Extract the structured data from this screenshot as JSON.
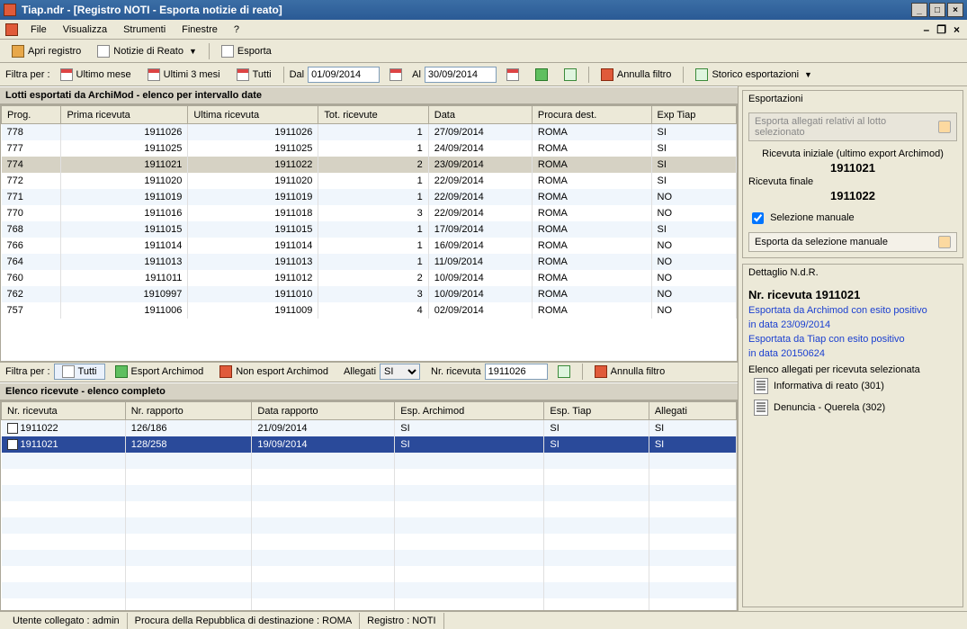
{
  "window": {
    "title": "Tiap.ndr - [Registro NOTI - Esporta notizie di reato]"
  },
  "menu": {
    "file": "File",
    "visualizza": "Visualizza",
    "strumenti": "Strumenti",
    "finestre": "Finestre",
    "help": "?"
  },
  "toolbar": {
    "apri_registro": "Apri registro",
    "notizie_di_reato": "Notizie di Reato",
    "esporta": "Esporta"
  },
  "filter_top": {
    "label": "Filtra per :",
    "ultimo_mese": "Ultimo mese",
    "ultimi_3_mesi": "Ultimi 3 mesi",
    "tutti": "Tutti",
    "dal_label": "Dal",
    "dal_value": "01/09/2014",
    "al_label": "Al",
    "al_value": "30/09/2014",
    "annulla_filtro": "Annulla filtro",
    "storico_esportazioni": "Storico esportazioni"
  },
  "grid_top": {
    "title": "Lotti esportati da ArchiMod - elenco per intervallo date",
    "columns": {
      "prog": "Prog.",
      "prima": "Prima ricevuta",
      "ultima": "Ultima ricevuta",
      "tot": "Tot. ricevute",
      "data": "Data",
      "procura": "Procura dest.",
      "exp": "Exp Tiap"
    },
    "rows": [
      {
        "prog": "778",
        "prima": "1911026",
        "ultima": "1911026",
        "tot": "1",
        "data": "27/09/2014",
        "procura": "ROMA",
        "exp": "SI",
        "sel": false
      },
      {
        "prog": "777",
        "prima": "1911025",
        "ultima": "1911025",
        "tot": "1",
        "data": "24/09/2014",
        "procura": "ROMA",
        "exp": "SI",
        "sel": false
      },
      {
        "prog": "774",
        "prima": "1911021",
        "ultima": "1911022",
        "tot": "2",
        "data": "23/09/2014",
        "procura": "ROMA",
        "exp": "SI",
        "sel": true
      },
      {
        "prog": "772",
        "prima": "1911020",
        "ultima": "1911020",
        "tot": "1",
        "data": "22/09/2014",
        "procura": "ROMA",
        "exp": "SI",
        "sel": false
      },
      {
        "prog": "771",
        "prima": "1911019",
        "ultima": "1911019",
        "tot": "1",
        "data": "22/09/2014",
        "procura": "ROMA",
        "exp": "NO",
        "sel": false
      },
      {
        "prog": "770",
        "prima": "1911016",
        "ultima": "1911018",
        "tot": "3",
        "data": "22/09/2014",
        "procura": "ROMA",
        "exp": "NO",
        "sel": false
      },
      {
        "prog": "768",
        "prima": "1911015",
        "ultima": "1911015",
        "tot": "1",
        "data": "17/09/2014",
        "procura": "ROMA",
        "exp": "SI",
        "sel": false
      },
      {
        "prog": "766",
        "prima": "1911014",
        "ultima": "1911014",
        "tot": "1",
        "data": "16/09/2014",
        "procura": "ROMA",
        "exp": "NO",
        "sel": false
      },
      {
        "prog": "764",
        "prima": "1911013",
        "ultima": "1911013",
        "tot": "1",
        "data": "11/09/2014",
        "procura": "ROMA",
        "exp": "NO",
        "sel": false
      },
      {
        "prog": "760",
        "prima": "1911011",
        "ultima": "1911012",
        "tot": "2",
        "data": "10/09/2014",
        "procura": "ROMA",
        "exp": "NO",
        "sel": false
      },
      {
        "prog": "762",
        "prima": "1910997",
        "ultima": "1911010",
        "tot": "3",
        "data": "10/09/2014",
        "procura": "ROMA",
        "exp": "NO",
        "sel": false
      },
      {
        "prog": "757",
        "prima": "1911006",
        "ultima": "1911009",
        "tot": "4",
        "data": "02/09/2014",
        "procura": "ROMA",
        "exp": "NO",
        "sel": false
      }
    ]
  },
  "filter_mid": {
    "label": "Filtra per :",
    "tutti": "Tutti",
    "esport_archimod": "Esport Archimod",
    "non_esport_archimod": "Non esport Archimod",
    "allegati_label": "Allegati",
    "allegati_value": "SI",
    "nr_ricevuta_label": "Nr. ricevuta",
    "nr_ricevuta_value": "1911026",
    "annulla_filtro": "Annulla filtro"
  },
  "grid_bot": {
    "title": "Elenco ricevute - elenco completo",
    "columns": {
      "nr_ricevuta": "Nr. ricevuta",
      "nr_rapporto": "Nr. rapporto",
      "data_rapporto": "Data rapporto",
      "esp_archimod": "Esp. Archimod",
      "esp_tiap": "Esp. Tiap",
      "allegati": "Allegati"
    },
    "rows": [
      {
        "chk": false,
        "nr_ricevuta": "1911022",
        "nr_rapporto": "126/186",
        "data_rapporto": "21/09/2014",
        "esp_archimod": "SI",
        "esp_tiap": "SI",
        "allegati": "SI",
        "sel": false
      },
      {
        "chk": true,
        "nr_ricevuta": "1911021",
        "nr_rapporto": "128/258",
        "data_rapporto": "19/09/2014",
        "esp_archimod": "SI",
        "esp_tiap": "SI",
        "allegati": "SI",
        "sel": true
      }
    ]
  },
  "export_panel": {
    "title": "Esportazioni",
    "btn_allegati": "Esporta allegati relativi al lotto selezionato",
    "ricevuta_iniziale_label": "Ricevuta iniziale (ultimo export Archimod)",
    "ricevuta_iniziale_value": "1911021",
    "ricevuta_finale_label": "Ricevuta finale",
    "ricevuta_finale_value": "1911022",
    "selezione_manuale": "Selezione manuale",
    "btn_manuale": "Esporta da selezione manuale"
  },
  "detail_panel": {
    "title": "Dettaglio N.d.R.",
    "heading": "Nr. ricevuta 1911021",
    "line1": "Esportata da Archimod con esito positivo",
    "line2": "in data 23/09/2014",
    "line3": "Esportata da Tiap con esito positivo",
    "line4": "in data 20150624",
    "allegati_label": "Elenco allegati per ricevuta selezionata",
    "attachments": [
      "Informativa di reato (301)",
      "Denuncia - Querela (302)"
    ]
  },
  "status": {
    "utente": "Utente collegato : admin",
    "procura": "Procura della Repubblica di destinazione : ROMA",
    "registro": "Registro : NOTI"
  }
}
